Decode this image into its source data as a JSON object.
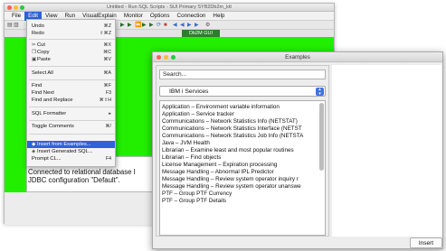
{
  "window": {
    "title": "Untitled - Run SQL Scripts - SUI Primary SYB2Db2m_ktt"
  },
  "menubar": [
    "File",
    "Edit",
    "View",
    "Run",
    "VisualExplain",
    "Monitor",
    "Options",
    "Connection",
    "Help"
  ],
  "tab": {
    "label": "Db2M GUI"
  },
  "output": {
    "line1": "Connected to relational database I",
    "line2": "JDBC configuration \"Default\"."
  },
  "edit_menu": {
    "undo": {
      "label": "Undo",
      "shortcut": "⌘Z"
    },
    "redo": {
      "label": "Redo",
      "shortcut": "⇧⌘Z"
    },
    "cut": {
      "label": "Cut",
      "shortcut": "⌘X"
    },
    "copy": {
      "label": "Copy",
      "shortcut": "⌘C"
    },
    "paste": {
      "label": "Paste",
      "shortcut": "⌘V"
    },
    "select_all": {
      "label": "Select All",
      "shortcut": "⌘A"
    },
    "find": {
      "label": "Find",
      "shortcut": "⌘F"
    },
    "find_next": {
      "label": "Find Next",
      "shortcut": "F3"
    },
    "find_replace": {
      "label": "Find and Replace",
      "shortcut": "⌘⇧H"
    },
    "sql_formatter": {
      "label": "SQL Formatter",
      "shortcut": "▸"
    },
    "toggle_comments": {
      "label": "Toggle Comments",
      "shortcut": "⌘/"
    },
    "insert_examples": {
      "label": "Insert from Examples..."
    },
    "insert_generated": {
      "label": "Insert Generated SQL..."
    },
    "prompt": {
      "label": "Prompt CL...",
      "shortcut": "F4"
    }
  },
  "dialog": {
    "title": "Examples",
    "search_placeholder": "Search...",
    "category": "IBM i Services",
    "items": [
      "Application – Environment variable information",
      "Application – Service tracker",
      "Communications – Network Statistics Info (NETSTAT)",
      "Communications – Network Statistics Interface (NETST",
      "Communications – Network Statistics Job Info (NETSTA",
      "Java – JVM Health",
      "Librarian – Examine least and most popular routines",
      "Librarian – Find objects",
      "License Management – Expiration processing",
      "Message Handling – Abnormal IPL Predictor",
      "Message Handling – Review system operator inquiry r",
      "Message Handling – Review system operator unanswe",
      "PTF – Group PTF Currency",
      "PTF – Group PTF Details"
    ],
    "insert_label": "Insert"
  }
}
